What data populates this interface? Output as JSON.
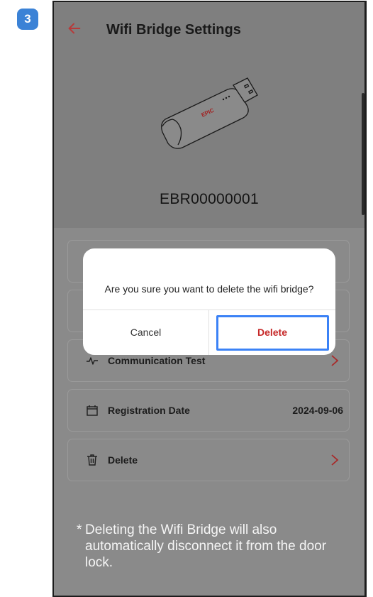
{
  "step_badge": "3",
  "appbar": {
    "title": "Wifi Bridge Settings"
  },
  "device": {
    "brand_text": "EPIC",
    "serial": "EBR00000001"
  },
  "items": [
    {
      "label": "",
      "value": ""
    },
    {
      "label": "",
      "value": ""
    },
    {
      "label": "Communication Test",
      "value": ""
    },
    {
      "label": "Registration Date",
      "value": "2024-09-06"
    },
    {
      "label": "Delete",
      "value": ""
    }
  ],
  "note": {
    "star": "*",
    "text": "Deleting the Wifi Bridge will also automatically disconnect it from the door lock."
  },
  "dialog": {
    "message": "Are you sure you want to delete the wifi bridge?",
    "cancel_label": "Cancel",
    "delete_label": "Delete"
  },
  "colors": {
    "accent": "#c62828",
    "highlight": "#3b82f6",
    "badge": "#3b82d6"
  },
  "icons": {
    "back": "arrow-left-icon",
    "communication": "pulse-icon",
    "date": "calendar-icon",
    "delete": "trash-icon",
    "chevron": "chevron-right-icon"
  }
}
